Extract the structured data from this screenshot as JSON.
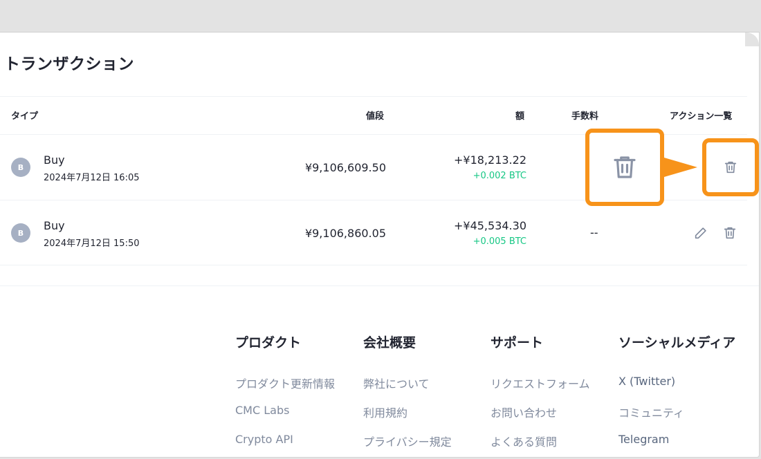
{
  "section_title": "トランザクション",
  "table": {
    "headers": {
      "type": "タイプ",
      "price": "値段",
      "amount": "額",
      "fee": "手数料",
      "actions": "アクション一覧"
    },
    "rows": [
      {
        "coin_letter": "B",
        "type": "Buy",
        "date": "2024年7月12日 16:05",
        "price": "¥9,106,609.50",
        "amount": "+¥18,213.22",
        "quantity": "+0.002 BTC",
        "fee": ""
      },
      {
        "coin_letter": "B",
        "type": "Buy",
        "date": "2024年7月12日 15:50",
        "price": "¥9,106,860.05",
        "amount": "+¥45,534.30",
        "quantity": "+0.005 BTC",
        "fee": "--"
      }
    ]
  },
  "icons": {
    "edit": "pencil-icon",
    "delete": "trash-icon"
  },
  "colors": {
    "highlight": "#f7931a",
    "positive": "#16c784",
    "badge": "#a6b0c3",
    "muted": "#808a9d"
  },
  "footer": {
    "columns": [
      {
        "heading": "プロダクト",
        "links": [
          "プロダクト更新情報",
          "CMC Labs",
          "Crypto API"
        ]
      },
      {
        "heading": "会社概要",
        "links": [
          "弊社について",
          "利用規約",
          "プライバシー規定"
        ]
      },
      {
        "heading": "サポート",
        "links": [
          "リクエストフォーム",
          "お問い合わせ",
          "よくある質問"
        ]
      },
      {
        "heading": "ソーシャルメディア",
        "links": [
          "X (Twitter)",
          "コミュニティ",
          "Telegram"
        ]
      }
    ]
  }
}
